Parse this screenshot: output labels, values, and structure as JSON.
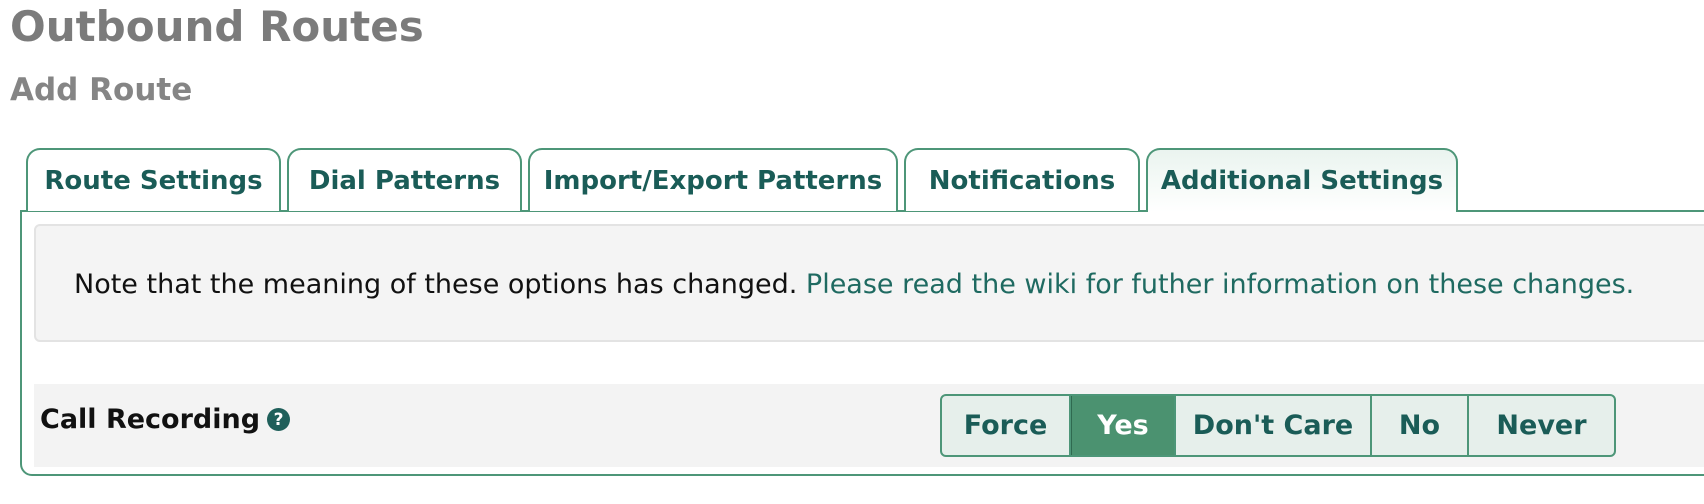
{
  "header": {
    "title": "Outbound Routes",
    "subtitle": "Add Route"
  },
  "tabs": [
    {
      "label": "Route Settings",
      "active": false
    },
    {
      "label": "Dial Patterns",
      "active": false
    },
    {
      "label": "Import/Export Patterns",
      "active": false
    },
    {
      "label": "Notifications",
      "active": false
    },
    {
      "label": "Additional Settings",
      "active": true
    }
  ],
  "note": {
    "text": "Note that the meaning of these options has changed.",
    "link_text": "Please read the wiki for futher information on these changes."
  },
  "call_recording": {
    "label": "Call Recording",
    "help_icon": "question-circle-icon",
    "help_glyph": "?",
    "options": [
      "Force",
      "Yes",
      "Don't Care",
      "No",
      "Never"
    ],
    "selected": "Yes"
  },
  "colors": {
    "accent": "#4d9678",
    "selected_bg": "#4b9270",
    "text_teal": "#1a5c57",
    "title_gray": "#7b7b7b"
  }
}
